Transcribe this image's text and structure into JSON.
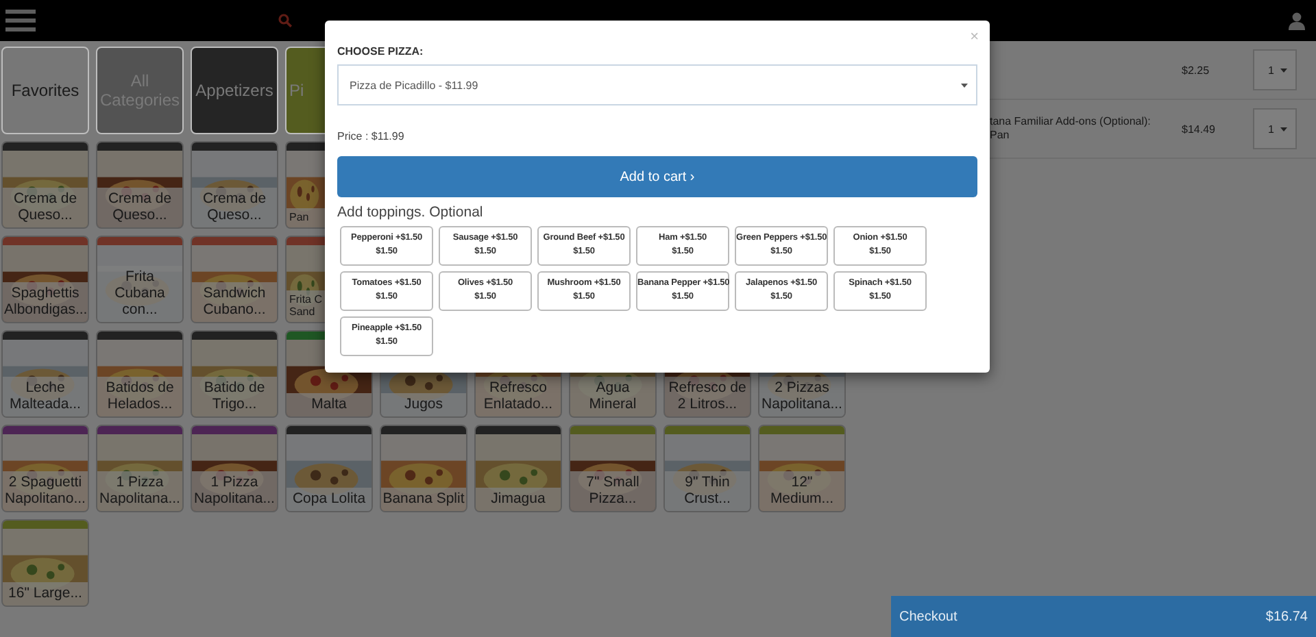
{
  "categories": [
    {
      "label": "Favorites",
      "color": "#777777",
      "text_light": false,
      "cut": false
    },
    {
      "label": "All Categories",
      "color": "#535353",
      "text_light": true,
      "cut": false
    },
    {
      "label": "Appetizers",
      "color": "#252525",
      "text_light": true,
      "cut": false
    },
    {
      "label": "Pi",
      "color": "#545c1f",
      "text_light": true,
      "cut": true
    }
  ],
  "product_rows": [
    [
      {
        "label": "Crema de Queso...",
        "color": "#222222",
        "cut": false
      },
      {
        "label": "Crema de Queso...",
        "color": "#222222",
        "cut": false
      },
      {
        "label": "Crema de Queso...",
        "color": "#222222",
        "cut": false
      },
      {
        "label": "Pan",
        "color": "#222222",
        "cut": true
      }
    ],
    [
      {
        "label": "Spaghettis Albondigas...",
        "color": "#703327",
        "cut": false
      },
      {
        "label": "Frita Cubana con...",
        "color": "#703327",
        "cut": false
      },
      {
        "label": "Sandwich Cubano...",
        "color": "#703327",
        "cut": false
      },
      {
        "label": "Frita C Sand",
        "color": "#703327",
        "cut": true
      }
    ],
    [
      {
        "label": "Leche Malteada...",
        "color": "#222222",
        "cut": false
      },
      {
        "label": "Batidos de Helados...",
        "color": "#222222",
        "cut": false
      },
      {
        "label": "Batido de Trigo...",
        "color": "#222222",
        "cut": false
      },
      {
        "label": "Malta",
        "color": "#1f5724",
        "cut": false
      },
      {
        "label": "Jugos",
        "cut": false
      },
      {
        "label": "Refresco Enlatado...",
        "cut": false
      },
      {
        "label": "Agua Mineral",
        "cut": false
      },
      {
        "label": "Refresco de 2 Litros...",
        "cut": false
      },
      {
        "label": "2 Pizzas Napolitana...",
        "cut": false
      }
    ],
    [
      {
        "label": "2 Spaguetti Napolitano...",
        "color": "#4d2554",
        "cut": false
      },
      {
        "label": "1 Pizza Napolitana...",
        "color": "#4d2554",
        "cut": false
      },
      {
        "label": "1 Pizza Napolitana...",
        "color": "#4d2554",
        "cut": false
      },
      {
        "label": "Copa Lolita",
        "color": "#222222",
        "cut": false
      },
      {
        "label": "Banana Split",
        "color": "#222222",
        "cut": false
      },
      {
        "label": "Jimagua",
        "color": "#222222",
        "cut": false
      },
      {
        "label": "7\" Small Pizza...",
        "color": "#545c1f",
        "cut": false
      },
      {
        "label": "9\" Thin Crust...",
        "color": "#545c1f",
        "cut": false
      },
      {
        "label": "12\" Medium...",
        "color": "#545c1f",
        "cut": false
      }
    ],
    [
      {
        "label": "16\" Large...",
        "color": "#545c1f",
        "cut": false
      }
    ]
  ],
  "cart": {
    "items": [
      {
        "price": "$2.25",
        "qty": "1"
      },
      {
        "name": "tana Familiar Add-ons (Optional): Pan",
        "price": "$14.49",
        "qty": "1"
      }
    ],
    "checkout": {
      "label": "Checkout",
      "total": "$16.74"
    }
  },
  "modal": {
    "close": "×",
    "heading": "CHOOSE PIZZA:",
    "select_value": "Pizza de Picadillo - $11.99",
    "price": "Price : $11.99",
    "add_button": "Add to cart ›",
    "toppings_title": "Add toppings. Optional",
    "toppings": [
      {
        "label": "Pepperoni +$1.50",
        "price": "$1.50"
      },
      {
        "label": "Sausage +$1.50",
        "price": "$1.50"
      },
      {
        "label": "Ground Beef +$1.50",
        "price": "$1.50"
      },
      {
        "label": "Ham +$1.50",
        "price": "$1.50"
      },
      {
        "label": "Green Peppers +$1.50",
        "price": "$1.50"
      },
      {
        "label": "Onion +$1.50",
        "price": "$1.50"
      },
      {
        "label": "Tomatoes +$1.50",
        "price": "$1.50"
      },
      {
        "label": "Olives +$1.50",
        "price": "$1.50"
      },
      {
        "label": "Mushroom +$1.50",
        "price": "$1.50"
      },
      {
        "label": "Banana Pepper +$1.50",
        "price": "$1.50"
      },
      {
        "label": "Jalapenos +$1.50",
        "price": "$1.50"
      },
      {
        "label": "Spinach +$1.50",
        "price": "$1.50"
      },
      {
        "label": "Pineapple +$1.50",
        "price": "$1.50"
      }
    ]
  }
}
